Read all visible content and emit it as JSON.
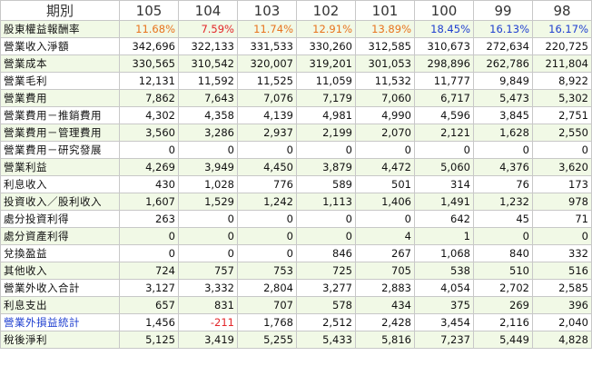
{
  "table": {
    "header_label": "期別",
    "years": [
      "105",
      "104",
      "103",
      "102",
      "101",
      "100",
      "99",
      "98"
    ],
    "rows": [
      {
        "label": "股東權益報酬率",
        "label_color": "",
        "values": [
          "11.68%",
          "7.59%",
          "11.74%",
          "12.91%",
          "13.89%",
          "18.45%",
          "16.13%",
          "16.17%"
        ],
        "colors": [
          "orange",
          "red",
          "orange",
          "orange",
          "orange",
          "blue",
          "blue",
          "blue"
        ]
      },
      {
        "label": "營業收入淨額",
        "label_color": "",
        "values": [
          "342,696",
          "322,133",
          "331,533",
          "330,260",
          "312,585",
          "310,673",
          "272,634",
          "220,725"
        ],
        "colors": [
          "",
          "",
          "",
          "",
          "",
          "",
          "",
          ""
        ]
      },
      {
        "label": "營業成本",
        "label_color": "",
        "values": [
          "330,565",
          "310,542",
          "320,007",
          "319,201",
          "301,053",
          "298,896",
          "262,786",
          "211,804"
        ],
        "colors": [
          "",
          "",
          "",
          "",
          "",
          "",
          "",
          ""
        ]
      },
      {
        "label": "營業毛利",
        "label_color": "",
        "values": [
          "12,131",
          "11,592",
          "11,525",
          "11,059",
          "11,532",
          "11,777",
          "9,849",
          "8,922"
        ],
        "colors": [
          "",
          "",
          "",
          "",
          "",
          "",
          "",
          ""
        ]
      },
      {
        "label": "營業費用",
        "label_color": "",
        "values": [
          "7,862",
          "7,643",
          "7,076",
          "7,179",
          "7,060",
          "6,717",
          "5,473",
          "5,302"
        ],
        "colors": [
          "",
          "",
          "",
          "",
          "",
          "",
          "",
          ""
        ]
      },
      {
        "label": "營業費用－推銷費用",
        "label_color": "",
        "values": [
          "4,302",
          "4,358",
          "4,139",
          "4,981",
          "4,990",
          "4,596",
          "3,845",
          "2,751"
        ],
        "colors": [
          "",
          "",
          "",
          "",
          "",
          "",
          "",
          ""
        ]
      },
      {
        "label": "營業費用－管理費用",
        "label_color": "",
        "values": [
          "3,560",
          "3,286",
          "2,937",
          "2,199",
          "2,070",
          "2,121",
          "1,628",
          "2,550"
        ],
        "colors": [
          "",
          "",
          "",
          "",
          "",
          "",
          "",
          ""
        ]
      },
      {
        "label": "營業費用－研究發展",
        "label_color": "",
        "values": [
          "0",
          "0",
          "0",
          "0",
          "0",
          "0",
          "0",
          "0"
        ],
        "colors": [
          "",
          "",
          "",
          "",
          "",
          "",
          "",
          ""
        ]
      },
      {
        "label": "營業利益",
        "label_color": "",
        "values": [
          "4,269",
          "3,949",
          "4,450",
          "3,879",
          "4,472",
          "5,060",
          "4,376",
          "3,620"
        ],
        "colors": [
          "",
          "",
          "",
          "",
          "",
          "",
          "",
          ""
        ]
      },
      {
        "label": "利息收入",
        "label_color": "",
        "values": [
          "430",
          "1,028",
          "776",
          "589",
          "501",
          "314",
          "76",
          "173"
        ],
        "colors": [
          "",
          "",
          "",
          "",
          "",
          "",
          "",
          ""
        ]
      },
      {
        "label": "投資收入／股利收入",
        "label_color": "",
        "values": [
          "1,607",
          "1,529",
          "1,242",
          "1,113",
          "1,406",
          "1,491",
          "1,232",
          "978"
        ],
        "colors": [
          "",
          "",
          "",
          "",
          "",
          "",
          "",
          ""
        ]
      },
      {
        "label": "處分投資利得",
        "label_color": "",
        "values": [
          "263",
          "0",
          "0",
          "0",
          "0",
          "642",
          "45",
          "71"
        ],
        "colors": [
          "",
          "",
          "",
          "",
          "",
          "",
          "",
          ""
        ]
      },
      {
        "label": "處分資產利得",
        "label_color": "",
        "values": [
          "0",
          "0",
          "0",
          "0",
          "4",
          "1",
          "0",
          "0"
        ],
        "colors": [
          "",
          "",
          "",
          "",
          "",
          "",
          "",
          ""
        ]
      },
      {
        "label": "兌換盈益",
        "label_color": "",
        "values": [
          "0",
          "0",
          "0",
          "846",
          "267",
          "1,068",
          "840",
          "332"
        ],
        "colors": [
          "",
          "",
          "",
          "",
          "",
          "",
          "",
          ""
        ]
      },
      {
        "label": "其他收入",
        "label_color": "",
        "values": [
          "724",
          "757",
          "753",
          "725",
          "705",
          "538",
          "510",
          "516"
        ],
        "colors": [
          "",
          "",
          "",
          "",
          "",
          "",
          "",
          ""
        ]
      },
      {
        "label": "營業外收入合計",
        "label_color": "",
        "values": [
          "3,127",
          "3,332",
          "2,804",
          "3,277",
          "2,883",
          "4,054",
          "2,702",
          "2,585"
        ],
        "colors": [
          "",
          "",
          "",
          "",
          "",
          "",
          "",
          ""
        ]
      },
      {
        "label": "利息支出",
        "label_color": "",
        "values": [
          "657",
          "831",
          "707",
          "578",
          "434",
          "375",
          "269",
          "396"
        ],
        "colors": [
          "",
          "",
          "",
          "",
          "",
          "",
          "",
          ""
        ]
      },
      {
        "label": "營業外損益統計",
        "label_color": "blue",
        "values": [
          "1,456",
          "-211",
          "1,768",
          "2,512",
          "2,428",
          "3,454",
          "2,116",
          "2,040"
        ],
        "colors": [
          "",
          "red",
          "",
          "",
          "",
          "",
          "",
          ""
        ]
      },
      {
        "label": "稅後淨利",
        "label_color": "",
        "values": [
          "5,125",
          "3,419",
          "5,255",
          "5,433",
          "5,816",
          "7,237",
          "5,449",
          "4,828"
        ],
        "colors": [
          "",
          "",
          "",
          "",
          "",
          "",
          "",
          ""
        ]
      }
    ]
  }
}
